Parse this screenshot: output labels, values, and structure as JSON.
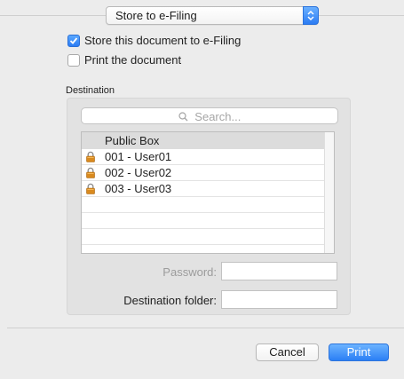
{
  "popup": {
    "selected": "Store to e-Filing"
  },
  "checkboxes": [
    {
      "label": "Store this document to e-Filing",
      "checked": true
    },
    {
      "label": "Print the document",
      "checked": false
    }
  ],
  "destination": {
    "label": "Destination",
    "search_placeholder": "Search...",
    "list_header": "Public Box",
    "list_items": [
      {
        "label": "001 - User01",
        "icon": "lock-icon"
      },
      {
        "label": "002 - User02",
        "icon": "lock-icon"
      },
      {
        "label": "003 - User03",
        "icon": "lock-icon"
      }
    ],
    "password_label": "Password:",
    "password_value": "",
    "folder_label": "Destination folder:",
    "folder_value": ""
  },
  "buttons": {
    "cancel": "Cancel",
    "print": "Print"
  },
  "colors": {
    "accent": "#2b7cf4",
    "background": "#ececec",
    "lock": "#d98a1f"
  }
}
